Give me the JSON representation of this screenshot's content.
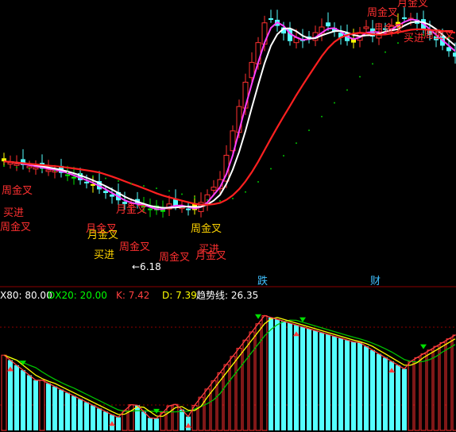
{
  "chart_data": {
    "type": "candlestick",
    "main": {
      "price_tag": "6.18",
      "signals": [
        {
          "text": "周金叉",
          "color": "#ff3030"
        },
        {
          "text": "买进",
          "color": "#ff3030"
        },
        {
          "text": "周金叉",
          "color": "#ff3030"
        },
        {
          "text": "月金叉",
          "color": "#ff3030"
        },
        {
          "text": "月金叉",
          "color": "#ffd400"
        },
        {
          "text": "月金叉",
          "color": "#ff3030"
        },
        {
          "text": "周金叉",
          "color": "#ff3030"
        },
        {
          "text": "买进",
          "color": "#ffd400"
        },
        {
          "text": "周金叉",
          "color": "#ff3030"
        },
        {
          "text": "周金叉",
          "color": "#ffd400"
        },
        {
          "text": "月金叉",
          "color": "#ff3030"
        },
        {
          "text": "买进",
          "color": "#ff3030"
        },
        {
          "text": "周金叉",
          "color": "#ff3030"
        },
        {
          "text": "月金叉",
          "color": "#ff3030"
        },
        {
          "text": "月金叉",
          "color": "#ff3030"
        },
        {
          "text": "买进",
          "color": "#ff3030"
        },
        {
          "text": "周金叉",
          "color": "#ff3030"
        }
      ],
      "period_tags": [
        {
          "text": "跌",
          "color": "#40c0ff"
        },
        {
          "text": "财",
          "color": "#40c0ff"
        }
      ]
    },
    "indicator_header": [
      {
        "text": "X80: 80.00",
        "color": "#ffffff"
      },
      {
        "text": "DX20: 20.00",
        "color": "#00ff00"
      },
      {
        "text": "K: 7.42",
        "color": "#ff4040"
      },
      {
        "text": "D: 7.39",
        "color": "#ffff00"
      },
      {
        "text": "趋势线: 26.35",
        "color": "#ffffff"
      }
    ],
    "colors": {
      "up": "#ff3030",
      "down": "#54ffff",
      "green_bar": "#00e000",
      "white_ma": "#ffffff",
      "magenta_ma": "#ff40ff",
      "red_ma": "#ff2020",
      "dots": "#00c000",
      "k_line": "#ff4040",
      "d_line": "#ffff00",
      "trend_line": "#00c000"
    }
  }
}
